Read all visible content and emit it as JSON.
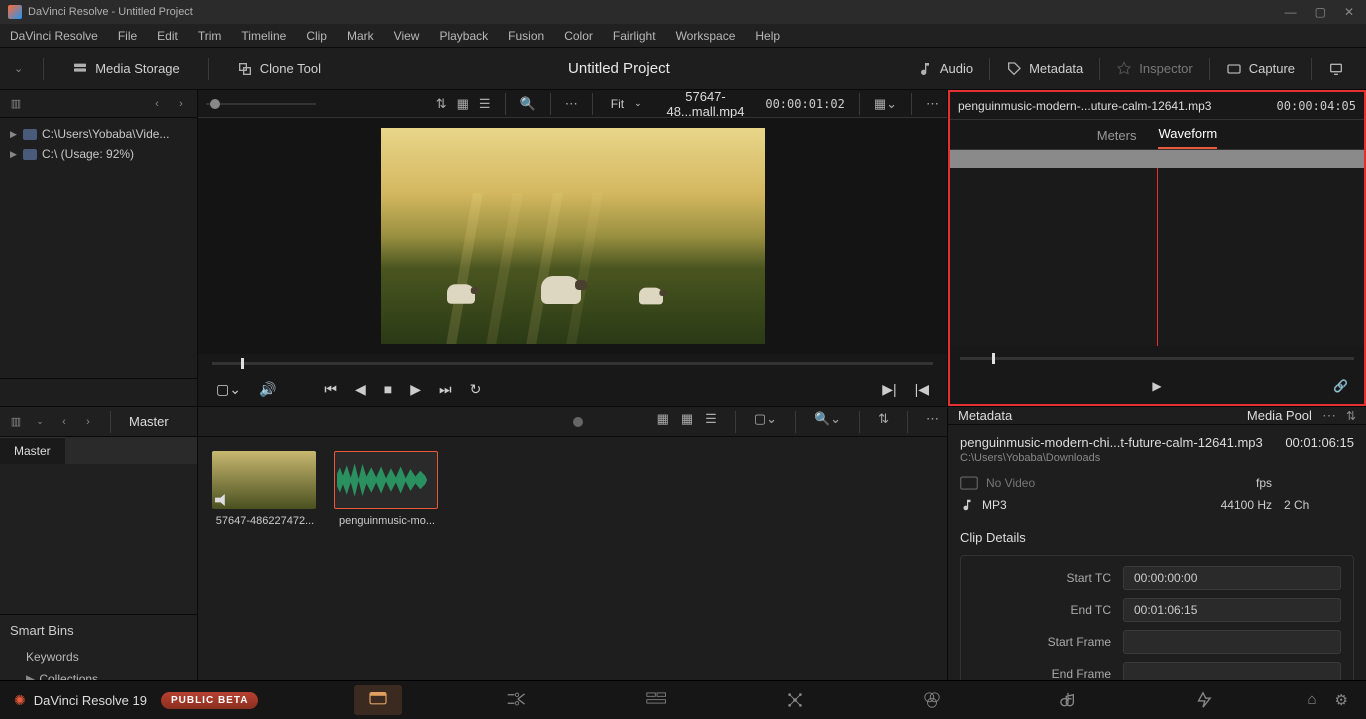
{
  "window": {
    "title": "DaVinci Resolve - Untitled Project"
  },
  "menu": [
    "DaVinci Resolve",
    "File",
    "Edit",
    "Trim",
    "Timeline",
    "Clip",
    "Mark",
    "View",
    "Playback",
    "Fusion",
    "Color",
    "Fairlight",
    "Workspace",
    "Help"
  ],
  "toolbar": {
    "media_storage": "Media Storage",
    "clone_tool": "Clone Tool",
    "project_title": "Untitled Project",
    "right": {
      "audio": "Audio",
      "metadata": "Metadata",
      "inspector": "Inspector",
      "capture": "Capture"
    }
  },
  "browser": {
    "paths": [
      {
        "label": "C:\\Users\\Yobaba\\Vide..."
      },
      {
        "label": "C:\\ (Usage: 92%)"
      }
    ]
  },
  "viewer": {
    "fit": "Fit",
    "clip": "57647-48...mall.mp4",
    "timecode": "00:00:01:02",
    "scrub_pos": "4%"
  },
  "audio_panel": {
    "clip": "penguinmusic-modern-...uture-calm-12641.mp3",
    "timecode": "00:00:04:05",
    "tabs": {
      "meters": "Meters",
      "waveform": "Waveform"
    },
    "scrub_pos": "8%"
  },
  "pool_header": {
    "master": "Master"
  },
  "master_tab": "Master",
  "smart_bins": {
    "header": "Smart Bins",
    "items": [
      "Keywords",
      "Collections"
    ]
  },
  "pool": {
    "clips": [
      {
        "kind": "video",
        "label": "57647-486227472..."
      },
      {
        "kind": "audio",
        "label": "penguinmusic-mo..."
      }
    ]
  },
  "meta": {
    "left_label": "Metadata",
    "right_label": "Media Pool",
    "name": "penguinmusic-modern-chi...t-future-calm-12641.mp3",
    "duration": "00:01:06:15",
    "path": "C:\\Users\\Yobaba\\Downloads",
    "novideo": "No Video",
    "fps": "fps",
    "format": "MP3",
    "rate": "44100 Hz",
    "channels": "2 Ch",
    "details_header": "Clip Details",
    "rows": [
      {
        "k": "Start TC",
        "v": "00:00:00:00"
      },
      {
        "k": "End TC",
        "v": "00:01:06:15"
      },
      {
        "k": "Start Frame",
        "v": ""
      },
      {
        "k": "End Frame",
        "v": ""
      }
    ]
  },
  "page_bar": {
    "brand": "DaVinci Resolve 19",
    "beta": "PUBLIC BETA"
  }
}
